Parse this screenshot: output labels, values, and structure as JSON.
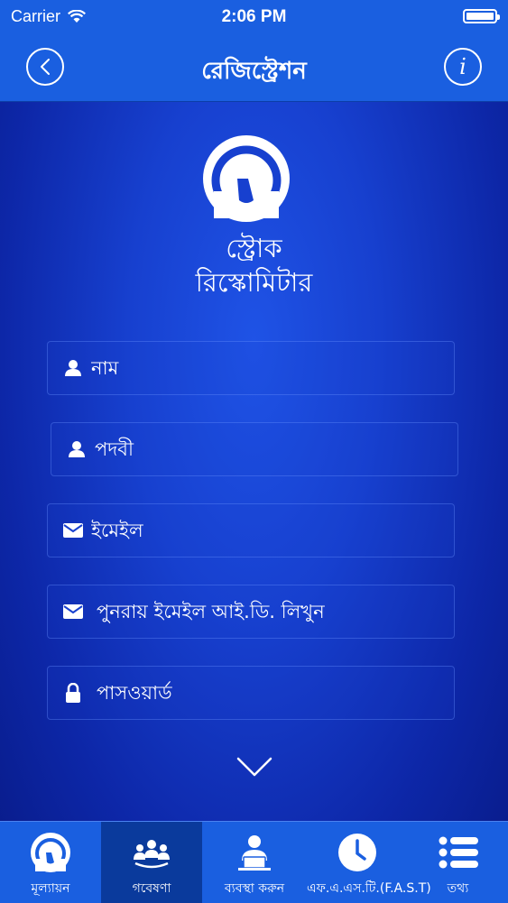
{
  "status_bar": {
    "carrier": "Carrier",
    "time": "2:06 PM"
  },
  "nav": {
    "title": "রেজিস্ট্রেশন"
  },
  "app": {
    "name_line1": "স্ট্রোক",
    "name_line2": "রিস্কোমিটার"
  },
  "form": {
    "fields": [
      {
        "placeholder": "নাম",
        "icon": "user-icon"
      },
      {
        "placeholder": "পদবী",
        "icon": "user-icon"
      },
      {
        "placeholder": "ইমেইল",
        "icon": "envelope-icon"
      },
      {
        "placeholder": "পুনরায় ইমেইল আই.ডি. লিখুন",
        "icon": "envelope-icon"
      },
      {
        "placeholder": "পাসওয়ার্ড",
        "icon": "lock-icon"
      }
    ]
  },
  "tabs": [
    {
      "label": "মূল্যায়ন",
      "icon": "gauge-icon"
    },
    {
      "label": "গবেষণা",
      "icon": "people-icon"
    },
    {
      "label": "ব্যবস্থা করুন",
      "icon": "person-laptop-icon"
    },
    {
      "label": "এফ.এ.এস.টি.(F.A.S.T)",
      "icon": "clock-icon"
    },
    {
      "label": "তথ্য",
      "icon": "list-icon"
    }
  ],
  "colors": {
    "bar": "#1a5fe0",
    "active_tab": "#0a3a9c",
    "background": "#1740cf"
  }
}
